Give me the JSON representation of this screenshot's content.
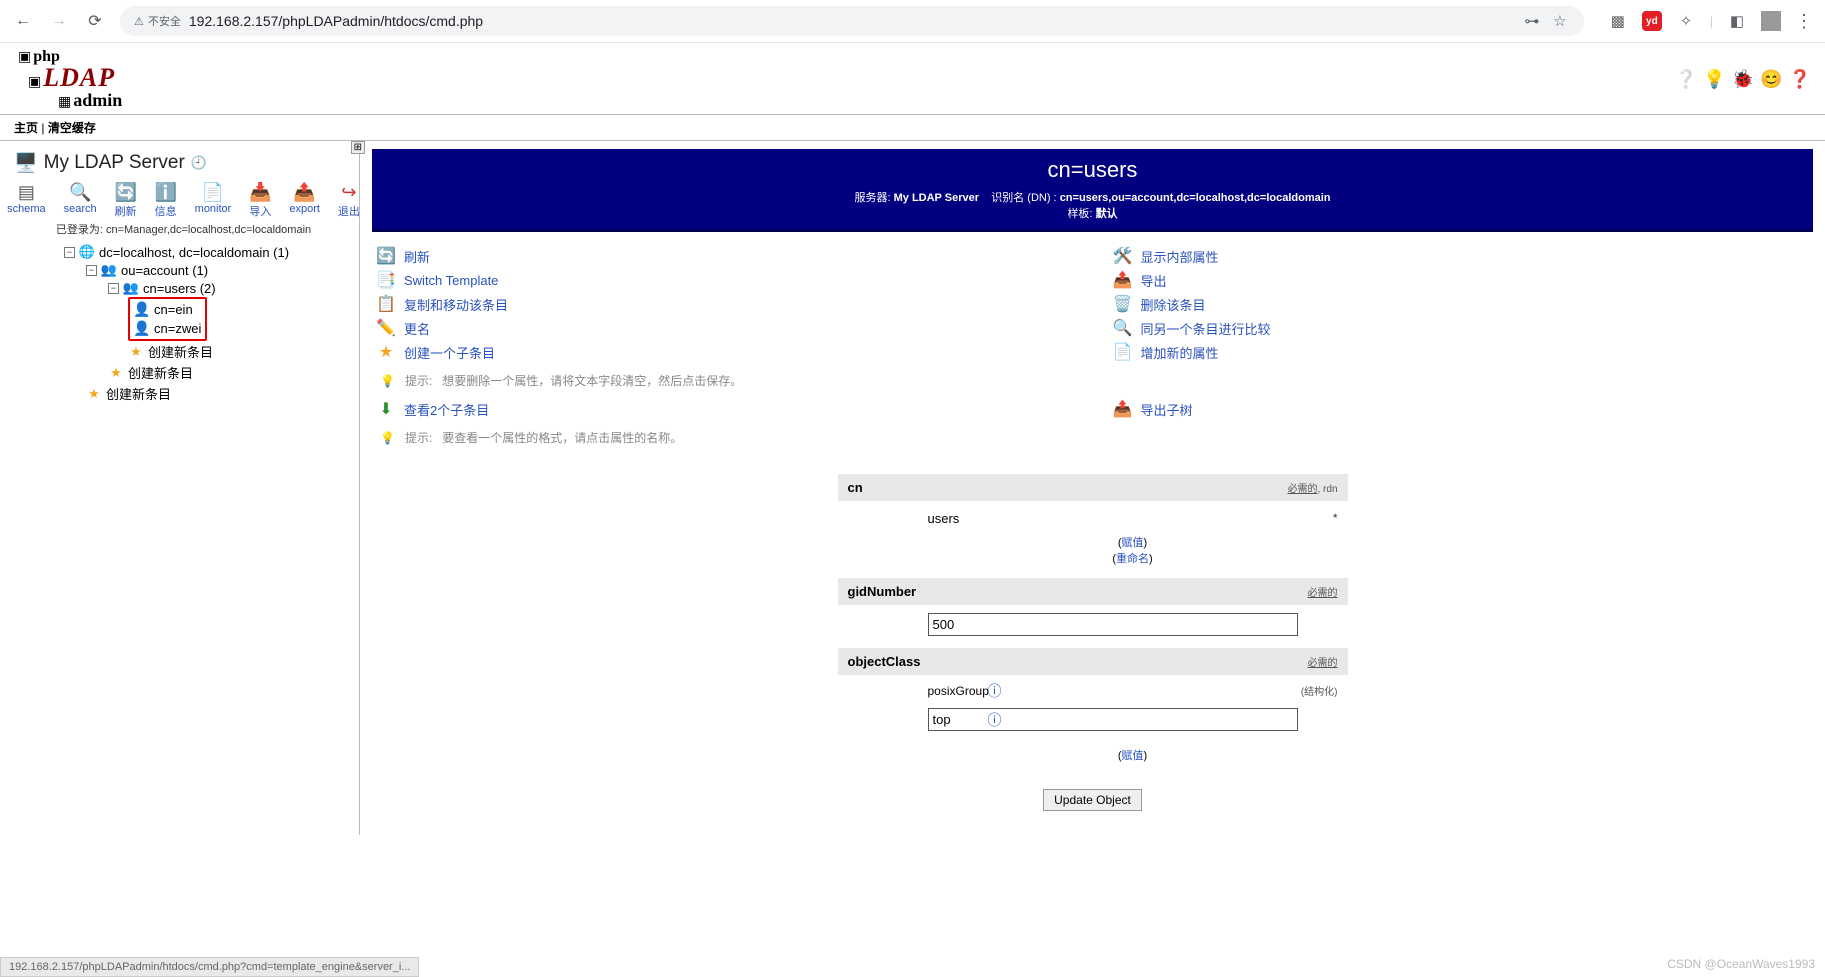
{
  "browser": {
    "insecure_label": "不安全",
    "url": "192.168.2.157/phpLDAPadmin/htdocs/cmd.php"
  },
  "nav": {
    "home": "主页",
    "purge": "清空缓存"
  },
  "server": {
    "title": "My LDAP Server",
    "login_prefix": "已登录为:",
    "login_dn": "cn=Manager,dc=localhost,dc=localdomain"
  },
  "tools": {
    "schema": "schema",
    "search": "search",
    "refresh": "刷新",
    "info": "信息",
    "monitor": "monitor",
    "import": "导入",
    "export": "export",
    "logout": "退出"
  },
  "tree": {
    "root": "dc=localhost, dc=localdomain (1)",
    "ou": "ou=account (1)",
    "cn_users": "cn=users (2)",
    "cn_ein": "cn=ein",
    "cn_zwei": "cn=zwei",
    "create": "创建新条目"
  },
  "header": {
    "title": "cn=users",
    "server_label": "服务器:",
    "server_name": "My LDAP Server",
    "dn_label": "识别名 (DN) :",
    "dn": "cn=users,ou=account,dc=localhost,dc=localdomain",
    "template_label": "样板:",
    "template": "默认"
  },
  "actions": {
    "refresh": "刷新",
    "show_internal": "显示内部属性",
    "switch_template": "Switch Template",
    "export": "导出",
    "copy_move": "复制和移动该条目",
    "delete": "删除该条目",
    "rename": "更名",
    "compare": "同另一个条目进行比较",
    "create_child": "创建一个子条目",
    "add_attr": "增加新的属性",
    "view_children": "查看2个子条目",
    "export_subtree": "导出子树",
    "hint_label": "提示:",
    "hint_delete_attr": "想要删除一个属性，请将文本字段清空，然后点击保存。",
    "hint_view_attr": "要查看一个属性的格式，请点击属性的名称。"
  },
  "attrs": {
    "cn": {
      "name": "cn",
      "value": "users",
      "meta_required": "必需的",
      "meta_rdn": "rdn",
      "assign": "赋值",
      "rename": "重命名"
    },
    "gidNumber": {
      "name": "gidNumber",
      "value": "500",
      "meta": "必需的"
    },
    "objectClass": {
      "name": "objectClass",
      "meta": "必需的",
      "v1": "posixGroup",
      "v1_meta": "(结构化)",
      "v2": "top",
      "assign": "赋值"
    }
  },
  "buttons": {
    "update": "Update Object"
  },
  "status_bar": "192.168.2.157/phpLDAPadmin/htdocs/cmd.php?cmd=template_engine&server_i...",
  "watermark": "CSDN @OceanWaves1993"
}
